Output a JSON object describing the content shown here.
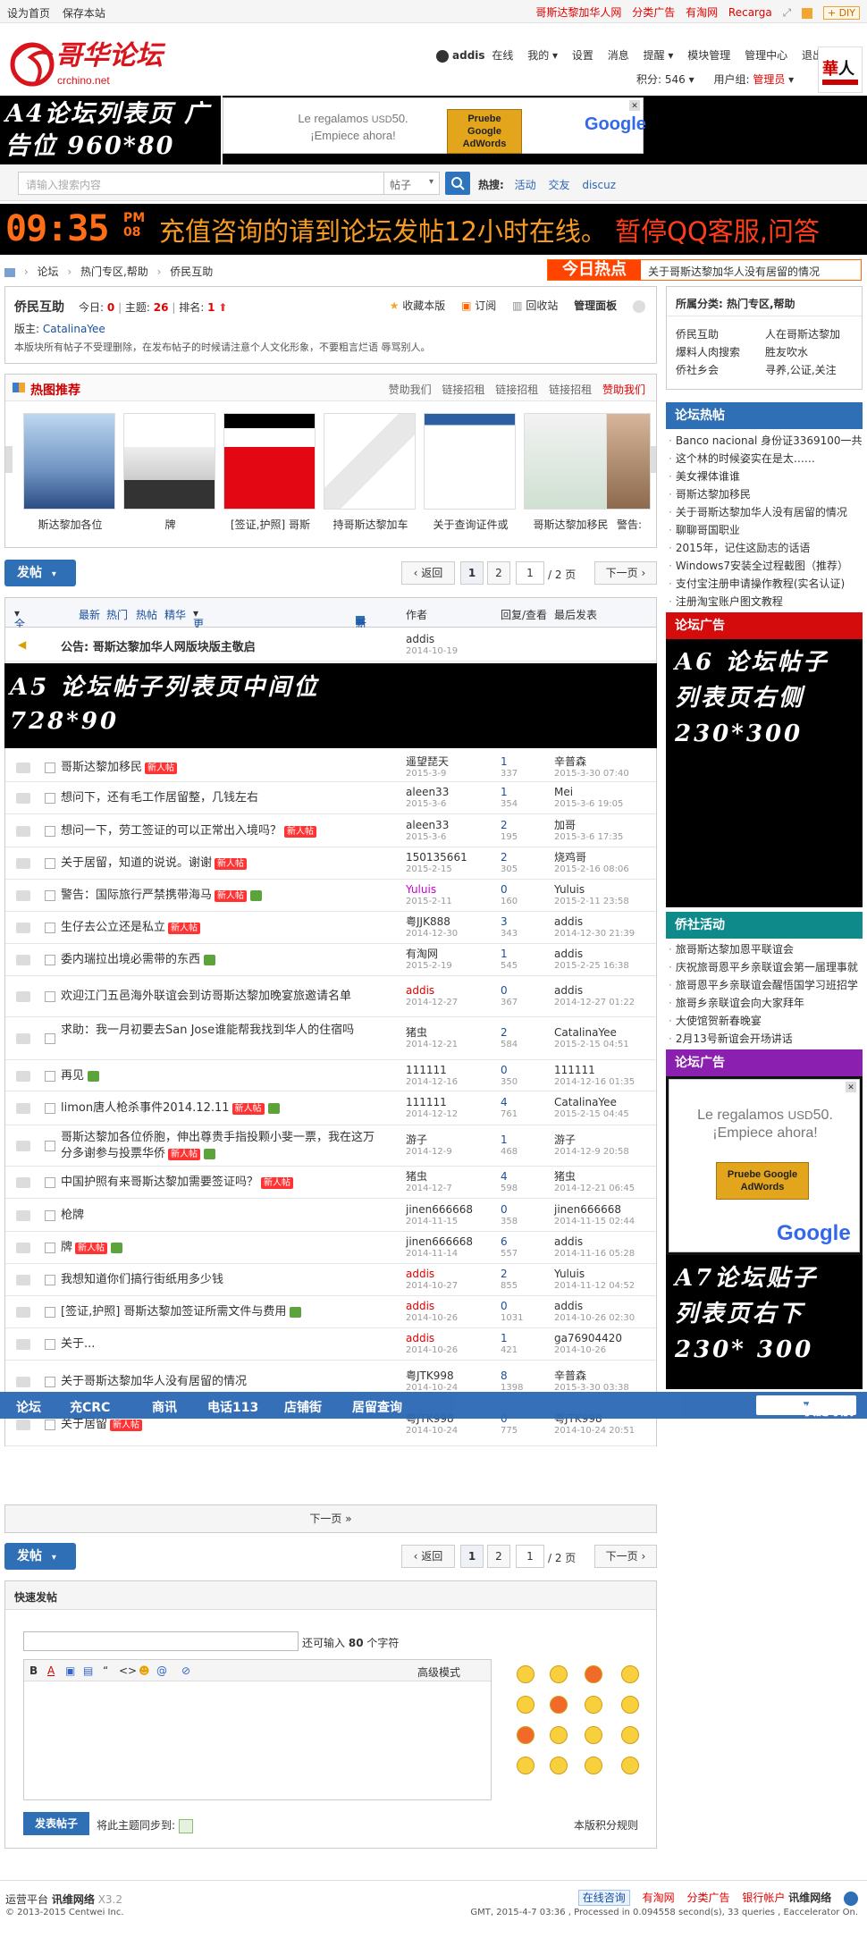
{
  "topbar": {
    "left": [
      "设为首页",
      "保存本站"
    ],
    "right": [
      "哥斯达黎加华人网",
      "分类广告",
      "有淘网",
      "Recarga"
    ],
    "diy": "DIY"
  },
  "site": {
    "logo_text": "哥华论坛",
    "logo_url": "crchino.net"
  },
  "user": {
    "name": "addis",
    "status": "在线",
    "links": [
      "我的",
      "设置",
      "消息",
      "提醒",
      "模块管理",
      "管理中心",
      "退出"
    ],
    "points_label": "积分:",
    "points": "546",
    "group_label": "用户组:",
    "group": "管理员"
  },
  "ads": {
    "a4": "A4论坛列表页 广告位 960*80",
    "google_line1": "Le regalamos",
    "google_usd": "USD",
    "google_amt": "50.",
    "google_line2": "¡Empiece ahora!",
    "google_btn": "Pruebe Google AdWords",
    "google_logo": "Google",
    "a5_line1": "A5 论坛帖子列表页中间位",
    "a5_line2": "728*90",
    "a6_lines": [
      "A6 论坛帖子",
      "列表页右侧",
      "230*300"
    ],
    "a7_lines": [
      "A7论坛贴子",
      "列表页右下",
      "230* 300"
    ]
  },
  "search": {
    "placeholder": "请输入搜索内容",
    "type": "帖子",
    "hot_label": "热搜:",
    "hot": [
      "活动",
      "交友",
      "discuz"
    ]
  },
  "clock": {
    "time": "09:35",
    "ampm": "PM",
    "sec": "08",
    "scroll": "充值咨询的请到论坛发帖12小时在线。",
    "scroll_red": "暂停QQ客服,问答"
  },
  "crumb": [
    "论坛",
    "热门专区,帮助",
    "侨民互助"
  ],
  "today": {
    "label": "今日热点",
    "text": "关于哥斯达黎加华人没有居留的情况"
  },
  "forum": {
    "title": "侨民互助",
    "today_label": "今日:",
    "today": "0",
    "topics_label": "主题:",
    "topics": "26",
    "rank_label": "排名:",
    "rank": "1",
    "tools": [
      "收藏本版",
      "订阅",
      "回收站",
      "管理面板"
    ],
    "mod_label": "版主:",
    "mod": "CatalinaYee",
    "rule": "本版块所有帖子不受理删除，在发布帖子的时候请注意个人文化形象，不要粗言烂语 辱骂别人。"
  },
  "category": {
    "title": "所属分类: 热门专区,帮助",
    "items": [
      "侨民互助",
      "人在哥斯达黎加",
      "爆料人肉搜索",
      "胜友吹水",
      "侨社乡会",
      "寻养,公证,关注"
    ]
  },
  "hotpic": {
    "title": "热图推荐",
    "links": [
      "赞助我们",
      "链接招租",
      "链接招租",
      "链接招租",
      "赞助我们"
    ],
    "items": [
      "斯达黎加各位",
      "牌",
      "[签证,护照] 哥斯",
      "持哥斯达黎加车",
      "关于查询证件或",
      "哥斯达黎加移民",
      "警告:"
    ]
  },
  "forum_hot": {
    "title": "论坛热帖",
    "items": [
      "Banco nacional 身份证3369100一共",
      "这个林的时候姿实在是太……",
      "美女裸体谁谁",
      "哥斯达黎加移民",
      "关于哥斯达黎加华人没有居留的情况",
      "聊聊哥国职业",
      "2015年，记住这励志的话语",
      "Windows7安装全过程截图（推荐）",
      "支付宝注册申请操作教程(实名认证)",
      "注册淘宝账户图文教程"
    ]
  },
  "forum_ad": {
    "title": "论坛广告"
  },
  "qiaoshe": {
    "title": "侨社活动",
    "items": [
      "旅哥斯达黎加恩平联谊会",
      "庆祝旅哥恩平乡亲联谊会第一届理事就",
      "旅哥恩平乡亲联谊会醒悟国学习班招学",
      "旅哥乡亲联谊会向大家拜年",
      "大使馆贺新春晚宴",
      "2月13号新谊会开场讲话"
    ]
  },
  "post": {
    "label": "发帖"
  },
  "pager": {
    "back": "返回",
    "p1": "1",
    "p2": "2",
    "input": "1",
    "total": "/ 2 页",
    "next": "下一页"
  },
  "thead": {
    "tabs": [
      "全部主题",
      "最新",
      "热门",
      "热帖",
      "精华",
      "更多"
    ],
    "newwin": "新窗",
    "author": "作者",
    "replies": "回复/查看",
    "last": "最后发表"
  },
  "notice": {
    "title": "公告: 哥斯达黎加华人网版块版主敬启",
    "author": "addis",
    "date": "2014-10-19"
  },
  "threads": [
    {
      "title": "哥斯达黎加移民",
      "new": true,
      "img": false,
      "author": "遥望琵天",
      "adate": "2015-3-9",
      "r": "1",
      "v": "337",
      "last": "辛普森",
      "ldate": "2015-3-30 07:40"
    },
    {
      "title": "想问下，还有毛工作居留整，几钱左右",
      "new": false,
      "img": false,
      "author": "aleen33",
      "adate": "2015-3-6",
      "r": "1",
      "v": "354",
      "last": "Mei",
      "ldate": "2015-3-6 19:05"
    },
    {
      "title": "想问一下，劳工签证的可以正常出入境吗？",
      "new": true,
      "img": false,
      "author": "aleen33",
      "adate": "2015-3-6",
      "r": "2",
      "v": "195",
      "last": "加哥",
      "ldate": "2015-3-6 17:35"
    },
    {
      "title": "关于居留，知道的说说。谢谢",
      "new": true,
      "img": false,
      "author": "150135661",
      "adate": "2015-2-15",
      "r": "2",
      "v": "305",
      "last": "烧鸡哥",
      "ldate": "2015-2-16 08:06"
    },
    {
      "title": "警告：国际旅行严禁携带海马",
      "new": true,
      "img": true,
      "author": "Yuluis",
      "adate": "2015-2-11",
      "r": "0",
      "v": "160",
      "last": "Yuluis",
      "ldate": "2015-2-11 23:58"
    },
    {
      "title": "生仔去公立还是私立",
      "new": true,
      "img": false,
      "author": "粤JJK888",
      "adate": "2014-12-30",
      "r": "3",
      "v": "343",
      "last": "addis",
      "ldate": "2014-12-30 21:39"
    },
    {
      "title": "委内瑞拉出境必需带的东西",
      "new": false,
      "img": true,
      "author": "有淘网",
      "adate": "2015-2-19",
      "r": "1",
      "v": "545",
      "last": "addis",
      "ldate": "2015-2-25 16:38"
    },
    {
      "title": "欢迎江门五邑海外联谊会到访哥斯达黎加晚宴旅邀请名单",
      "new": false,
      "img": false,
      "author": "addis",
      "adate": "2014-12-27",
      "r": "0",
      "v": "367",
      "last": "addis",
      "ldate": "2014-12-27 01:22"
    },
    {
      "title": "求助：我一月初要去San Jose谁能帮我找到华人的住宿吗",
      "new": false,
      "img": false,
      "author": "猪虫",
      "adate": "2014-12-21",
      "r": "2",
      "v": "584",
      "last": "CatalinaYee",
      "ldate": "2015-2-15 04:51"
    },
    {
      "title": "再见",
      "new": false,
      "img": true,
      "author": "111111",
      "adate": "2014-12-16",
      "r": "0",
      "v": "350",
      "last": "111111",
      "ldate": "2014-12-16 01:35"
    },
    {
      "title": "limon唐人枪杀事件2014.12.11",
      "new": true,
      "img": true,
      "author": "111111",
      "adate": "2014-12-12",
      "r": "4",
      "v": "761",
      "last": "CatalinaYee",
      "ldate": "2015-2-15 04:45"
    },
    {
      "title": "哥斯达黎加各位侨胞，伸出尊贵手指投颗小斐一票，我在这万分多谢参与投票华侨",
      "new": true,
      "img": true,
      "author": "游子",
      "adate": "2014-12-9",
      "r": "1",
      "v": "468",
      "last": "游子",
      "ldate": "2014-12-9 20:58"
    },
    {
      "title": "中国护照有来哥斯达黎加需要签证吗？",
      "new": true,
      "img": false,
      "author": "猪虫",
      "adate": "2014-12-7",
      "r": "4",
      "v": "598",
      "last": "猪虫",
      "ldate": "2014-12-21 06:45"
    },
    {
      "title": "枪牌",
      "new": false,
      "img": false,
      "author": "jinen666668",
      "adate": "2014-11-15",
      "r": "0",
      "v": "358",
      "last": "jinen666668",
      "ldate": "2014-11-15 02:44"
    },
    {
      "title": "牌",
      "new": true,
      "img": true,
      "author": "jinen666668",
      "adate": "2014-11-14",
      "r": "6",
      "v": "557",
      "last": "addis",
      "ldate": "2014-11-16 05:28"
    },
    {
      "title": "我想知道你们搞行街纸用多少钱",
      "new": false,
      "img": false,
      "author": "addis",
      "adate": "2014-10-27",
      "r": "2",
      "v": "855",
      "last": "Yuluis",
      "ldate": "2014-11-12 04:52"
    },
    {
      "title": "[签证,护照] 哥斯达黎加签证所需文件与费用",
      "new": false,
      "img": true,
      "author": "addis",
      "adate": "2014-10-26",
      "r": "0",
      "v": "1031",
      "last": "addis",
      "ldate": "2014-10-26 02:30"
    },
    {
      "title": "关于...",
      "new": false,
      "img": false,
      "author": "addis",
      "adate": "2014-10-26",
      "r": "1",
      "v": "421",
      "last": "ga76904420",
      "ldate": "2014-10-26"
    },
    {
      "title": "关于哥斯达黎加华人没有居留的情况",
      "new": false,
      "img": false,
      "author": "粤JTK998",
      "adate": "2014-10-24",
      "r": "8",
      "v": "1398",
      "last": "辛普森",
      "ldate": "2015-3-30 03:38"
    },
    {
      "title": "关于居留",
      "new": true,
      "img": false,
      "author": "粤JTK998",
      "adate": "2014-10-24",
      "r": "0",
      "v": "775",
      "last": "粤JTK998",
      "ldate": "2014-10-24 20:51"
    }
  ],
  "bnav": {
    "items": [
      "论坛",
      "充CRC",
      "商讯",
      "电话113",
      "店铺街",
      "居留查询"
    ],
    "quick": "快捷导航"
  },
  "nextpage": "下一页 »",
  "quick": {
    "title": "快速发帖",
    "limit_pre": "还可输入",
    "limit": "80",
    "limit_post": "个字符",
    "tools": [
      "B",
      "A",
      "▣",
      "▤",
      "“",
      "<>",
      "☻",
      "@",
      "⊘"
    ],
    "adv": "高级模式",
    "submit": "发表帖子",
    "sync": "将此主题同步到:",
    "rules": "本版积分规则"
  },
  "footer": {
    "platform": "运营平台",
    "brand": "讯维网络",
    "version": "X3.2",
    "copy": "© 2013-2015 Centwei Inc.",
    "links": [
      "在线咨询",
      "有淘网",
      "分类广告",
      "银行帐户",
      "讯维网络"
    ],
    "status": "GMT, 2015-4-7 03:36 , Processed in 0.094558 second(s), 33 queries , Eaccelerator On."
  },
  "colors": {
    "blue": "#2f6fb5",
    "red": "#e00000",
    "orange": "#ff6d16",
    "teal": "#0f8a8a",
    "purple": "#8a1fb0"
  }
}
